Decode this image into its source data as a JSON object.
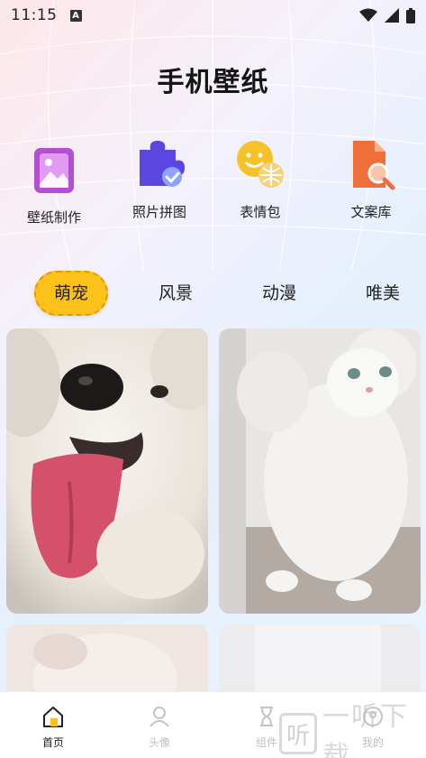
{
  "status_bar": {
    "time": "11:15",
    "notif_letter": "A"
  },
  "header": {
    "title": "手机壁纸"
  },
  "features": [
    {
      "label": "壁纸制作",
      "icon": "wallpaper-make-icon",
      "color": "#c354d6"
    },
    {
      "label": "照片拼图",
      "icon": "puzzle-icon",
      "color": "#6a4de6"
    },
    {
      "label": "表情包",
      "icon": "emoji-icon",
      "color": "#f6c229"
    },
    {
      "label": "文案库",
      "icon": "document-search-icon",
      "color": "#f07a3a"
    }
  ],
  "tabs": [
    {
      "label": "萌宠",
      "active": true
    },
    {
      "label": "风景",
      "active": false
    },
    {
      "label": "动漫",
      "active": false
    },
    {
      "label": "唯美",
      "active": false
    }
  ],
  "photos": [
    {
      "subject": "dog-photo"
    },
    {
      "subject": "cat-photo"
    },
    {
      "subject": "pet-photo-3"
    },
    {
      "subject": "pet-photo-4"
    }
  ],
  "tabbar": [
    {
      "label": "首页",
      "icon": "home-icon",
      "active": true
    },
    {
      "label": "头像",
      "icon": "avatar-icon",
      "active": false
    },
    {
      "label": "组件",
      "icon": "hourglass-icon",
      "active": false
    },
    {
      "label": "我的",
      "icon": "profile-icon",
      "active": false
    }
  ],
  "watermark": {
    "glyph": "听",
    "text": "一听下载"
  },
  "colors": {
    "accent": "#fcc219",
    "accent_border": "#e39a00"
  }
}
